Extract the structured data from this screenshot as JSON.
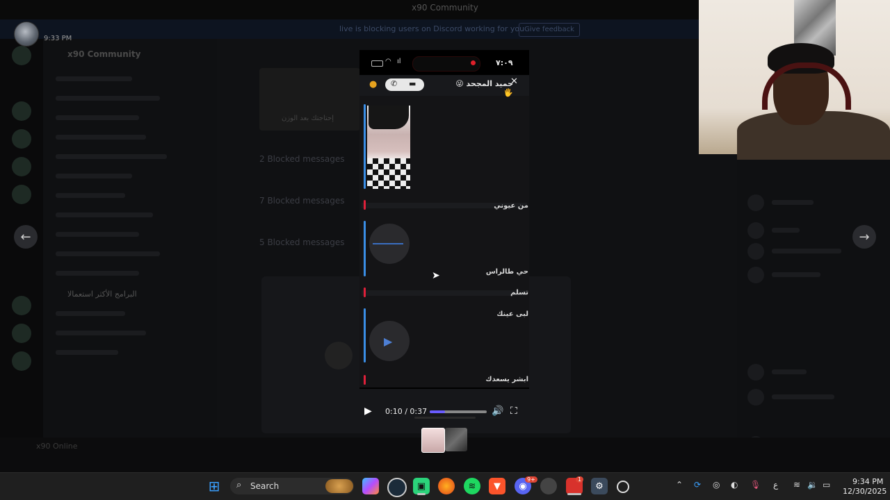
{
  "window": {
    "title": "x90 Community"
  },
  "notice": {
    "text": "live is blocking users on Discord working for you",
    "button": "Give feedback"
  },
  "server": {
    "name": "x90 Community",
    "active_channel": "البرامج الأكثر استعمالا"
  },
  "chat": {
    "blocked_1": "2 Blocked messages",
    "blocked_2": "7 Blocked messages",
    "blocked_3": "5 Blocked messages",
    "banner_text": "إحتاجتك بعد الوزن"
  },
  "viewer": {
    "posted_time": "9:33 PM",
    "prev_label": "←",
    "next_label": "→"
  },
  "phone": {
    "clock": "٧:٠٩",
    "contact_name": "حميد المجحد",
    "contact_emoji": "😜🖐",
    "close": "✕",
    "messages": [
      "من عيوني",
      "حي طالراس",
      "تسلم",
      "لبى عينك",
      "ابشر يسعدك"
    ]
  },
  "video": {
    "current": "0:10",
    "duration": "0:37",
    "separator": " / ",
    "progress": 0.27
  },
  "taskbar": {
    "search_placeholder": "Search",
    "discord_badge": "9+",
    "redapp_badge": "1",
    "tray_lang": "ع",
    "time": "9:34 PM",
    "date": "12/30/2025"
  },
  "user": {
    "name": "x90",
    "status": "Online"
  },
  "colors": {
    "accent": "#6a5cff",
    "voice_bar": "#3a8ee6",
    "unread_bar": "#e0203a"
  }
}
